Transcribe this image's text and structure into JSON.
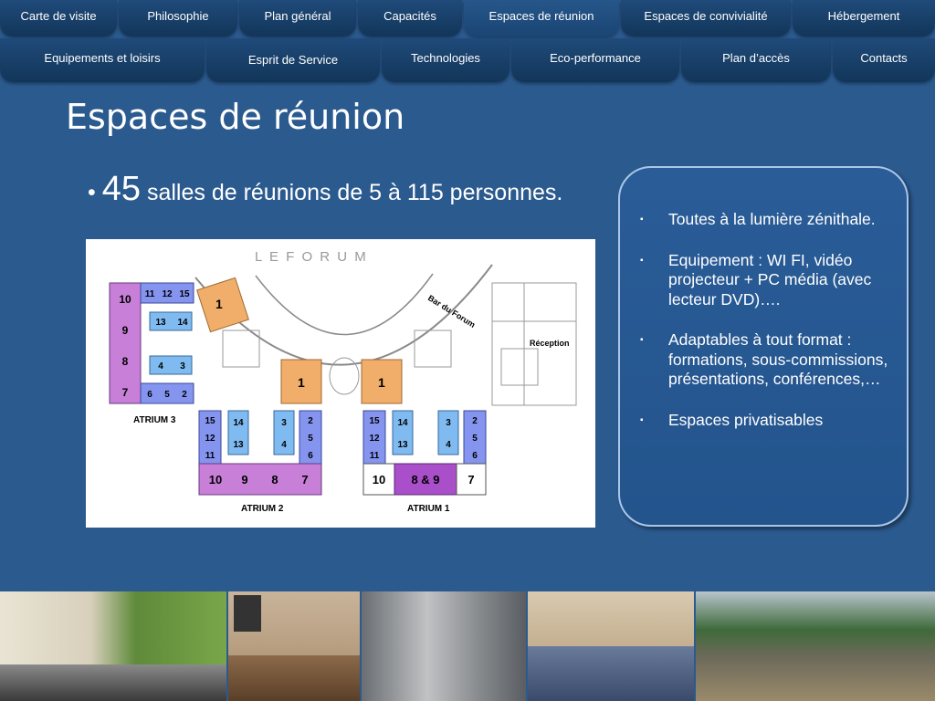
{
  "nav": {
    "row1": [
      "Carte de visite",
      "Philosophie",
      "Plan général",
      "Capacités",
      "Espaces de réunion",
      "Espaces de convivialité",
      "Hébergement"
    ],
    "row2": [
      "Equipements et loisirs",
      "Esprit de Service",
      "Technologies",
      "Eco-performance",
      "Plan d’accès",
      "Contacts"
    ]
  },
  "slide": {
    "title": "Espaces de réunion",
    "headline_bullet": "•",
    "headline_number": "45",
    "headline_text": "salles de réunions de 5 à 115 personnes."
  },
  "plan": {
    "title": "L  E     F  O  R  U  M",
    "bar_label": "Bar du Forum",
    "reception_label": "Réception",
    "atrium3": "ATRIUM 3",
    "atrium2": "ATRIUM 2",
    "atrium1": "ATRIUM 1",
    "a3_left": [
      "10",
      "9",
      "8",
      "7"
    ],
    "a3_top": [
      "11",
      "12",
      "15"
    ],
    "a3_mid": [
      "13",
      "14"
    ],
    "a3_mid2": [
      "4",
      "3"
    ],
    "a3_bottom": [
      "6",
      "5",
      "2"
    ],
    "a2_col1": [
      "15",
      "12",
      "11"
    ],
    "a2_col2": [
      "14",
      "13"
    ],
    "a2_col3": [
      "3",
      "4"
    ],
    "a2_col4": [
      "2",
      "5",
      "6"
    ],
    "a2_bottom": [
      "10",
      "9",
      "8",
      "7"
    ],
    "a1_col1": [
      "15",
      "12",
      "11"
    ],
    "a1_col2": [
      "14",
      "13"
    ],
    "a1_col3": [
      "3",
      "4"
    ],
    "a1_col4": [
      "2",
      "5",
      "6"
    ],
    "a1_bottom": [
      "10",
      "8 & 9",
      "7"
    ],
    "forum_rooms": [
      "1",
      "1",
      "1"
    ]
  },
  "callout": {
    "bullet_glyph": "▪",
    "items": [
      "Toutes à la lumière zénithale.",
      "Equipement : WI FI, vidéo projecteur + PC média (avec lecteur DVD)….",
      "Adaptables à tout format : formations, sous-commissions, présentations, conférences,…",
      "Espaces privatisables"
    ]
  },
  "colors": {
    "background": "#2b5a8f",
    "nav": "#1a4574",
    "room_purple": "#c77fd8",
    "room_blue": "#8494ef",
    "room_lightblue": "#7fbaf0",
    "room_orange": "#f0ae6a"
  }
}
